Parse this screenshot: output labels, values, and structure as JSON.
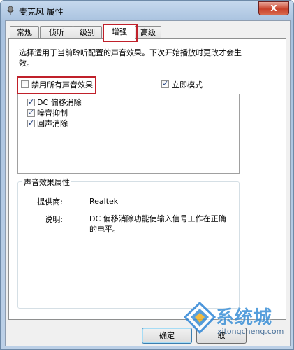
{
  "window": {
    "title": "麦克风 属性",
    "close_label": "X"
  },
  "tabs": [
    {
      "label": "常规"
    },
    {
      "label": "侦听"
    },
    {
      "label": "级别"
    },
    {
      "label": "增强"
    },
    {
      "label": "高级"
    }
  ],
  "enhance": {
    "description": "选择适用于当前聆听配置的声音效果。下次开始播放时更改才会生效。",
    "disable_all": {
      "label": "禁用所有声音效果",
      "checked": false
    },
    "immediate_mode": {
      "label": "立即模式",
      "checked": true
    },
    "effects": [
      {
        "label": "DC 偏移消除",
        "checked": true
      },
      {
        "label": "噪音抑制",
        "checked": true
      },
      {
        "label": "回声消除",
        "checked": true
      }
    ],
    "properties": {
      "title": "声音效果属性",
      "provider_label": "提供商:",
      "provider_value": "Realtek",
      "desc_label": "说明:",
      "desc_value": "DC 偏移消除功能使输入信号工作在正确的电平。"
    }
  },
  "buttons": {
    "ok": "确定",
    "cancel": "取"
  },
  "watermark": {
    "brand": "系统城",
    "url": "xitongcheng.com"
  }
}
